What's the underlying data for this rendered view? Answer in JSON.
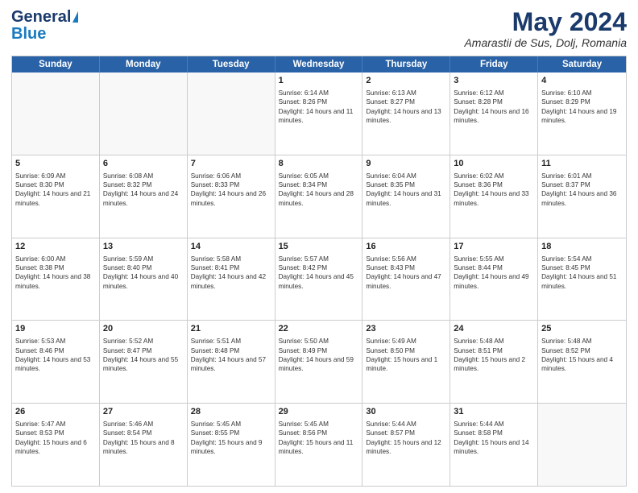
{
  "header": {
    "logo_general": "General",
    "logo_blue": "Blue",
    "month_title": "May 2024",
    "location": "Amarastii de Sus, Dolj, Romania"
  },
  "calendar": {
    "days_of_week": [
      "Sunday",
      "Monday",
      "Tuesday",
      "Wednesday",
      "Thursday",
      "Friday",
      "Saturday"
    ],
    "weeks": [
      [
        {
          "day": "",
          "empty": true
        },
        {
          "day": "",
          "empty": true
        },
        {
          "day": "",
          "empty": true
        },
        {
          "day": "1",
          "sunrise": "6:14 AM",
          "sunset": "8:26 PM",
          "daylight": "14 hours and 11 minutes."
        },
        {
          "day": "2",
          "sunrise": "6:13 AM",
          "sunset": "8:27 PM",
          "daylight": "14 hours and 13 minutes."
        },
        {
          "day": "3",
          "sunrise": "6:12 AM",
          "sunset": "8:28 PM",
          "daylight": "14 hours and 16 minutes."
        },
        {
          "day": "4",
          "sunrise": "6:10 AM",
          "sunset": "8:29 PM",
          "daylight": "14 hours and 19 minutes."
        }
      ],
      [
        {
          "day": "5",
          "sunrise": "6:09 AM",
          "sunset": "8:30 PM",
          "daylight": "14 hours and 21 minutes."
        },
        {
          "day": "6",
          "sunrise": "6:08 AM",
          "sunset": "8:32 PM",
          "daylight": "14 hours and 24 minutes."
        },
        {
          "day": "7",
          "sunrise": "6:06 AM",
          "sunset": "8:33 PM",
          "daylight": "14 hours and 26 minutes."
        },
        {
          "day": "8",
          "sunrise": "6:05 AM",
          "sunset": "8:34 PM",
          "daylight": "14 hours and 28 minutes."
        },
        {
          "day": "9",
          "sunrise": "6:04 AM",
          "sunset": "8:35 PM",
          "daylight": "14 hours and 31 minutes."
        },
        {
          "day": "10",
          "sunrise": "6:02 AM",
          "sunset": "8:36 PM",
          "daylight": "14 hours and 33 minutes."
        },
        {
          "day": "11",
          "sunrise": "6:01 AM",
          "sunset": "8:37 PM",
          "daylight": "14 hours and 36 minutes."
        }
      ],
      [
        {
          "day": "12",
          "sunrise": "6:00 AM",
          "sunset": "8:38 PM",
          "daylight": "14 hours and 38 minutes."
        },
        {
          "day": "13",
          "sunrise": "5:59 AM",
          "sunset": "8:40 PM",
          "daylight": "14 hours and 40 minutes."
        },
        {
          "day": "14",
          "sunrise": "5:58 AM",
          "sunset": "8:41 PM",
          "daylight": "14 hours and 42 minutes."
        },
        {
          "day": "15",
          "sunrise": "5:57 AM",
          "sunset": "8:42 PM",
          "daylight": "14 hours and 45 minutes."
        },
        {
          "day": "16",
          "sunrise": "5:56 AM",
          "sunset": "8:43 PM",
          "daylight": "14 hours and 47 minutes."
        },
        {
          "day": "17",
          "sunrise": "5:55 AM",
          "sunset": "8:44 PM",
          "daylight": "14 hours and 49 minutes."
        },
        {
          "day": "18",
          "sunrise": "5:54 AM",
          "sunset": "8:45 PM",
          "daylight": "14 hours and 51 minutes."
        }
      ],
      [
        {
          "day": "19",
          "sunrise": "5:53 AM",
          "sunset": "8:46 PM",
          "daylight": "14 hours and 53 minutes."
        },
        {
          "day": "20",
          "sunrise": "5:52 AM",
          "sunset": "8:47 PM",
          "daylight": "14 hours and 55 minutes."
        },
        {
          "day": "21",
          "sunrise": "5:51 AM",
          "sunset": "8:48 PM",
          "daylight": "14 hours and 57 minutes."
        },
        {
          "day": "22",
          "sunrise": "5:50 AM",
          "sunset": "8:49 PM",
          "daylight": "14 hours and 59 minutes."
        },
        {
          "day": "23",
          "sunrise": "5:49 AM",
          "sunset": "8:50 PM",
          "daylight": "15 hours and 1 minute."
        },
        {
          "day": "24",
          "sunrise": "5:48 AM",
          "sunset": "8:51 PM",
          "daylight": "15 hours and 2 minutes."
        },
        {
          "day": "25",
          "sunrise": "5:48 AM",
          "sunset": "8:52 PM",
          "daylight": "15 hours and 4 minutes."
        }
      ],
      [
        {
          "day": "26",
          "sunrise": "5:47 AM",
          "sunset": "8:53 PM",
          "daylight": "15 hours and 6 minutes."
        },
        {
          "day": "27",
          "sunrise": "5:46 AM",
          "sunset": "8:54 PM",
          "daylight": "15 hours and 8 minutes."
        },
        {
          "day": "28",
          "sunrise": "5:45 AM",
          "sunset": "8:55 PM",
          "daylight": "15 hours and 9 minutes."
        },
        {
          "day": "29",
          "sunrise": "5:45 AM",
          "sunset": "8:56 PM",
          "daylight": "15 hours and 11 minutes."
        },
        {
          "day": "30",
          "sunrise": "5:44 AM",
          "sunset": "8:57 PM",
          "daylight": "15 hours and 12 minutes."
        },
        {
          "day": "31",
          "sunrise": "5:44 AM",
          "sunset": "8:58 PM",
          "daylight": "15 hours and 14 minutes."
        },
        {
          "day": "",
          "empty": true
        }
      ]
    ]
  }
}
